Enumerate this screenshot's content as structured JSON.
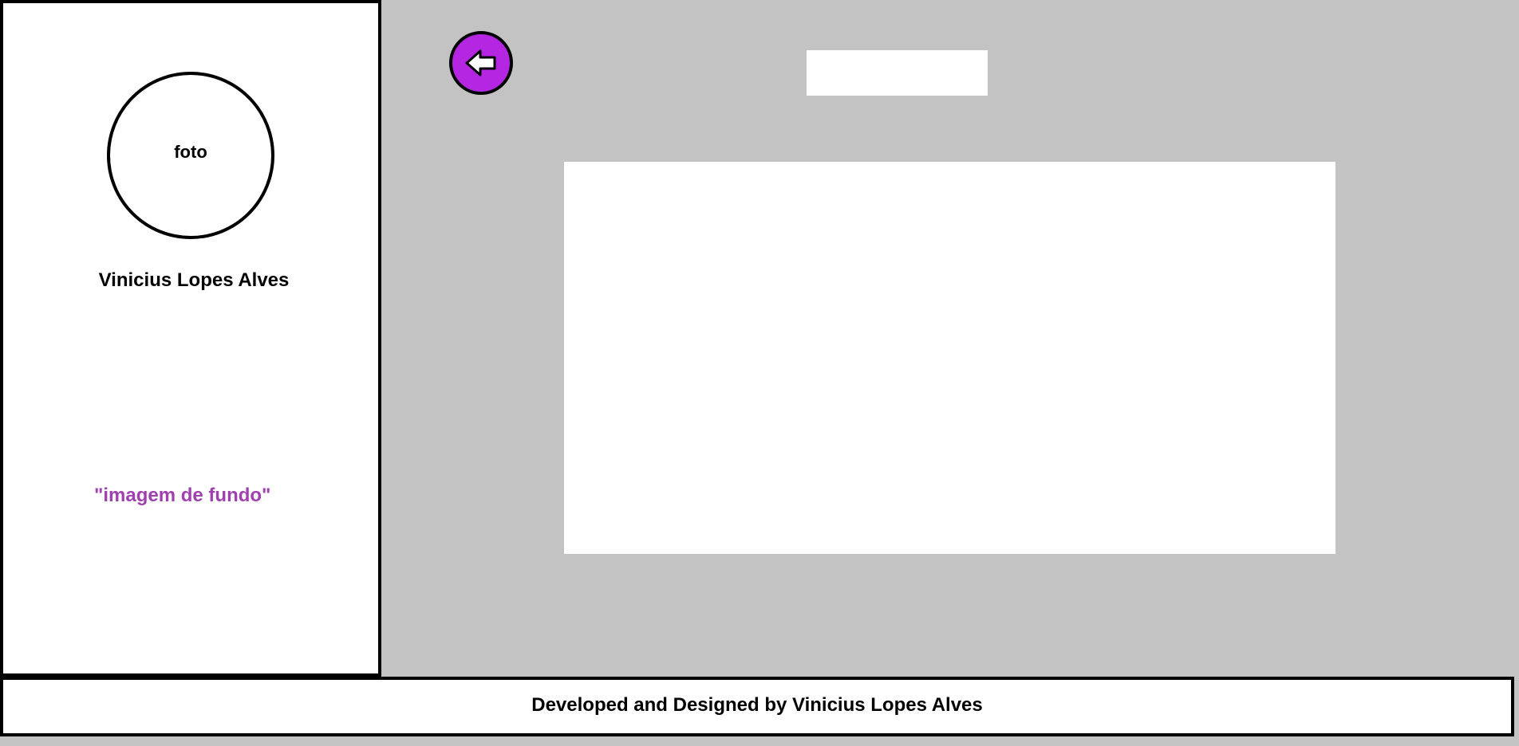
{
  "sidebar": {
    "photo_label": "foto",
    "profile_name": "Vinicius Lopes Alves",
    "background_note": "\"imagem de fundo\""
  },
  "header": {
    "back_icon": "arrow-left-icon",
    "title": ""
  },
  "main": {
    "content": ""
  },
  "footer": {
    "credit": "Developed and Designed by Vinicius Lopes Alves"
  },
  "colors": {
    "background": "#c3c3c3",
    "panel": "#ffffff",
    "accent_purple": "#b526e3",
    "note_purple": "#a040b0",
    "border": "#000000"
  }
}
